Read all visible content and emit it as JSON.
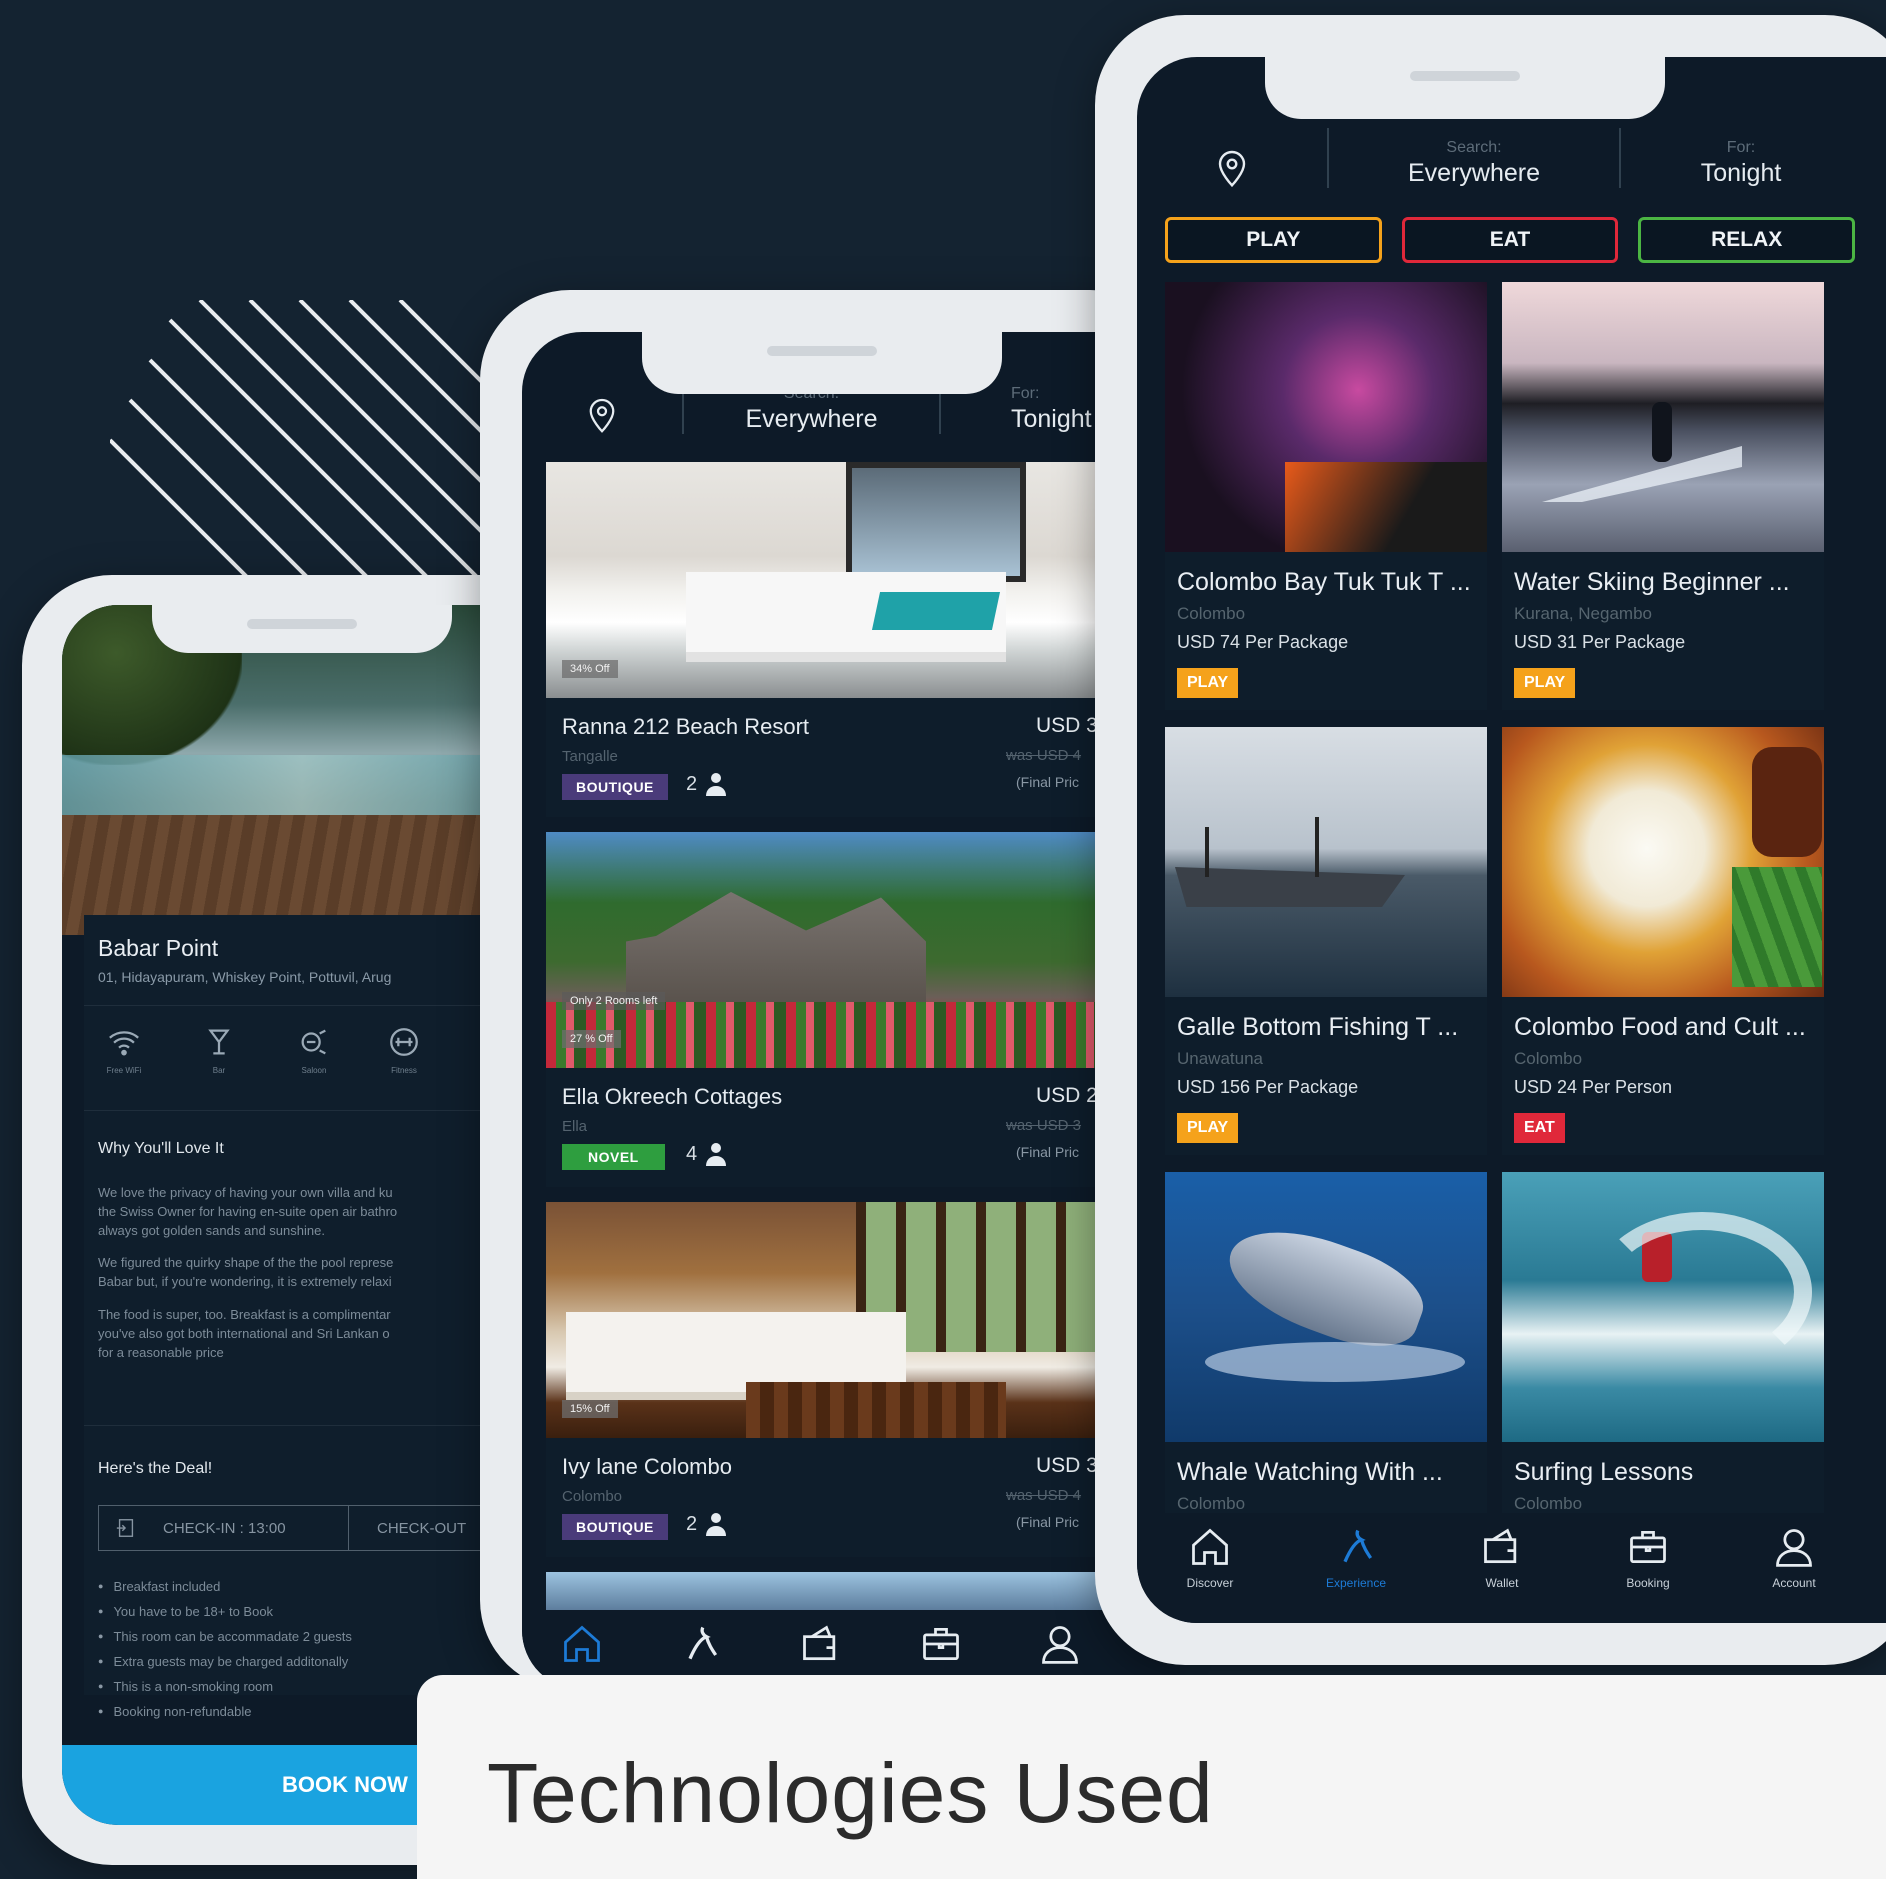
{
  "colors": {
    "background": "#142331",
    "screen": "#0d1a28",
    "accent_blue": "#1d7bd6",
    "book_now": "#1aa3e0",
    "play": "#f5a21b",
    "eat": "#e0283a",
    "relax": "#4bb543",
    "boutique": "#4a3b7a",
    "novel": "#2e9e3f"
  },
  "search": {
    "label": "Search:",
    "value": "Everywhere"
  },
  "for": {
    "label": "For:",
    "value": "Tonight"
  },
  "phone1": {
    "title": "Babar Point",
    "address": "01, Hidayapuram, Whiskey Point, Pottuvil, Arug",
    "amenities": [
      {
        "label": "Free WiFi",
        "icon": "wifi-icon"
      },
      {
        "label": "Bar",
        "icon": "bar-icon"
      },
      {
        "label": "Saloon",
        "icon": "saloon-icon"
      },
      {
        "label": "Fitness",
        "icon": "fitness-icon"
      }
    ],
    "why_heading": "Why You'll Love It",
    "paragraphs": [
      "We love the privacy of having your own villa and ku\nthe Swiss Owner for having en-suite open air bathro\nalways got golden sands and sunshine.",
      "We figured the quirky shape of the the pool represe\nBabar but, if you're wondering, it is extremely relaxi",
      "The food is super, too. Breakfast is a complimentar\nyou've also got both international and Sri Lankan o\nfor a reasonable price"
    ],
    "deal_heading": "Here's the Deal!",
    "check_in": "CHECK-IN : 13:00",
    "check_out": "CHECK-OUT",
    "deal_items": [
      "Breakfast included",
      "You have to be 18+ to Book",
      "This room can be accommadate 2 guests",
      "Extra guests may be charged additonally",
      "This is a non-smoking room",
      "Booking non-refundable"
    ],
    "book_now": "BOOK NOW"
  },
  "phone2": {
    "listings": [
      {
        "offer": "34% Off",
        "name": "Ranna 212 Beach Resort",
        "location": "Tangalle",
        "tag": "BOUTIQUE",
        "tag_color": "#4a3b7a",
        "guests": "2",
        "price": "USD 3",
        "was": "was USD 4",
        "final": "(Final Pric"
      },
      {
        "offer": "27 % Off",
        "offer2": "Only 2 Rooms left",
        "name": "Ella Okreech Cottages",
        "location": "Ella",
        "tag": "NOVEL",
        "tag_color": "#2e9e3f",
        "guests": "4",
        "price": "USD 2",
        "was": "was USD 3",
        "final": "(Final Pric"
      },
      {
        "offer": "15% Off",
        "name": "Ivy lane Colombo",
        "location": "Colombo",
        "tag": "BOUTIQUE",
        "tag_color": "#4a3b7a",
        "guests": "2",
        "price": "USD 3",
        "was": "was USD 4",
        "final": "(Final Pric"
      }
    ]
  },
  "phone3": {
    "categories": [
      {
        "label": "PLAY",
        "color": "#f5a21b"
      },
      {
        "label": "EAT",
        "color": "#e0283a"
      },
      {
        "label": "RELAX",
        "color": "#4bb543"
      }
    ],
    "experiences": [
      {
        "title": "Colombo Bay Tuk Tuk T ...",
        "location": "Colombo",
        "price": "USD 74 Per Package",
        "badge": "PLAY"
      },
      {
        "title": "Water Skiing Beginner ...",
        "location": "Kurana, Negambo",
        "price": "USD 31 Per Package",
        "badge": "PLAY"
      },
      {
        "title": "Galle Bottom Fishing T ...",
        "location": "Unawatuna",
        "price": "USD 156 Per Package",
        "badge": "PLAY"
      },
      {
        "title": "Colombo Food and Cult ...",
        "location": "Colombo",
        "price": "USD 24 Per Person",
        "badge": "EAT"
      },
      {
        "title": "Whale Watching With ...",
        "location": "Colombo",
        "price": "",
        "badge": ""
      },
      {
        "title": "Surfing Lessons",
        "location": "Colombo",
        "price": "",
        "badge": ""
      }
    ]
  },
  "nav": [
    {
      "label": "Discover",
      "icon": "home-icon"
    },
    {
      "label": "Experience",
      "icon": "experience-icon"
    },
    {
      "label": "Wallet",
      "icon": "wallet-icon"
    },
    {
      "label": "Booking",
      "icon": "briefcase-icon"
    },
    {
      "label": "Account",
      "icon": "user-icon"
    }
  ],
  "caption": "Technologies Used"
}
